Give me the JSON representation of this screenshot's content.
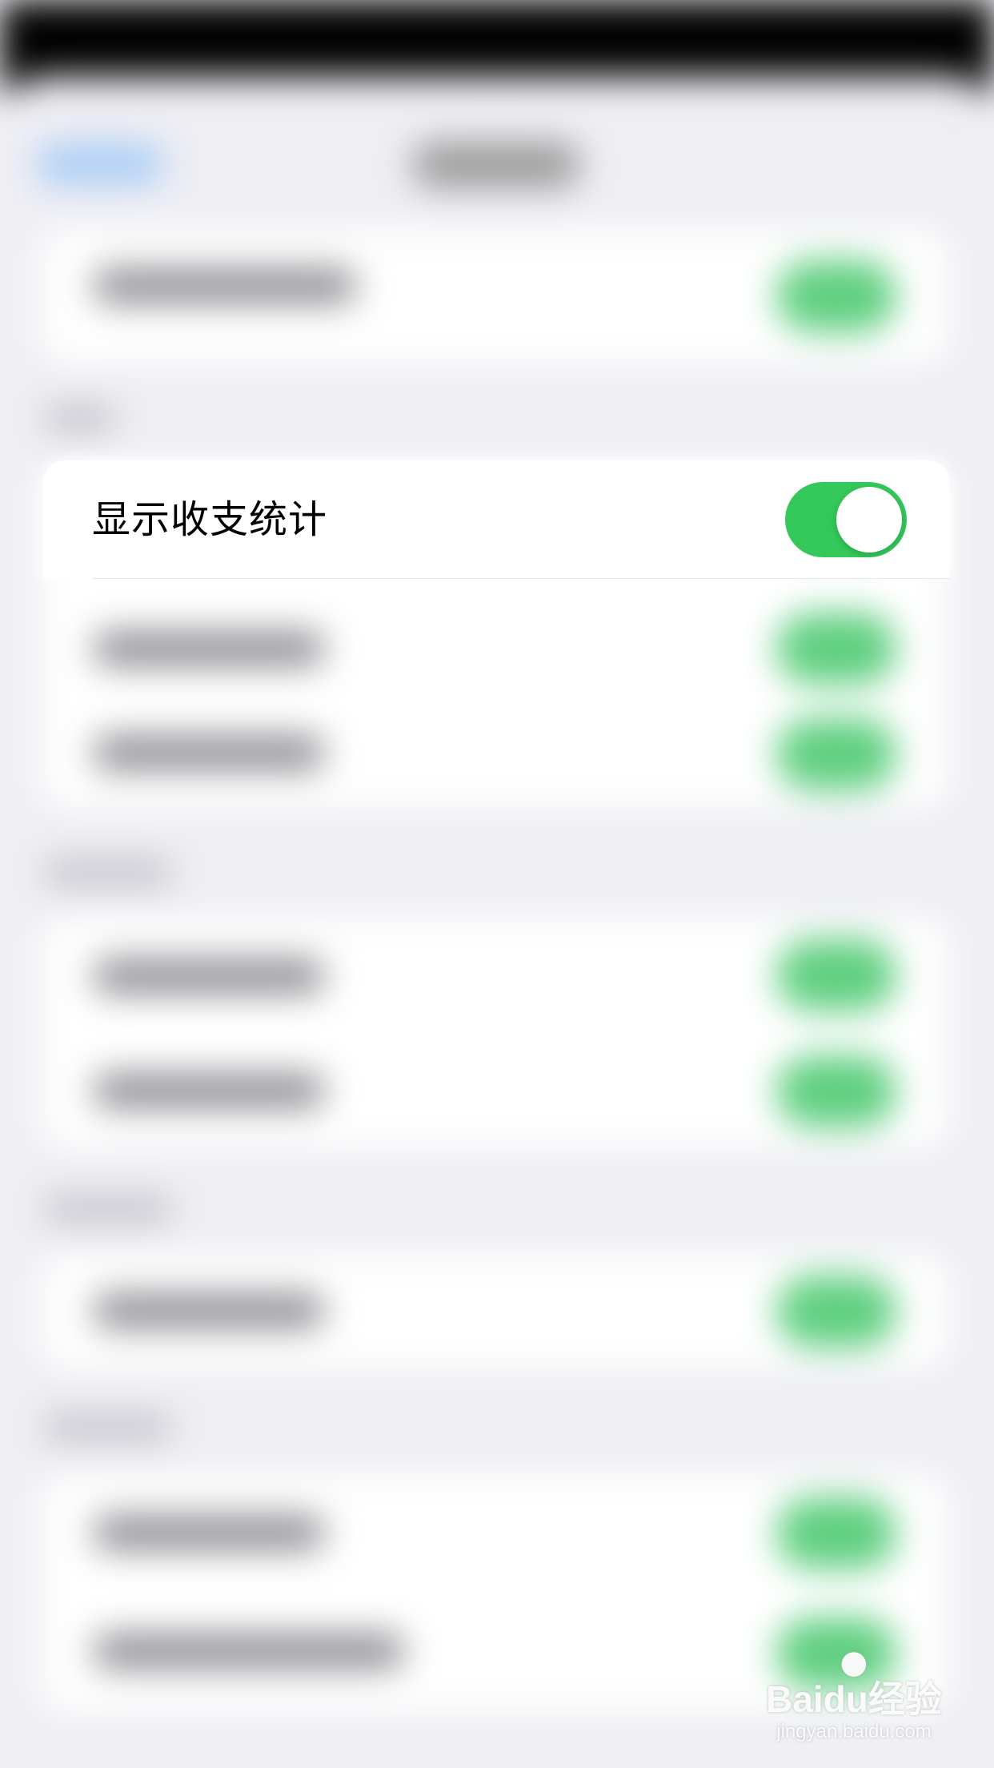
{
  "focused_setting": {
    "label": "显示收支统计",
    "toggle_on": true
  },
  "watermark": {
    "brand": "Baidu经验",
    "url": "jingyan.baidu.com"
  },
  "colors": {
    "toggle_on": "#34c759",
    "background": "#f1f1f5",
    "card": "#ffffff",
    "status_bar": "#000000",
    "nav_back_accent": "#a9cdf6"
  },
  "icons": [
    "paw-icon"
  ]
}
